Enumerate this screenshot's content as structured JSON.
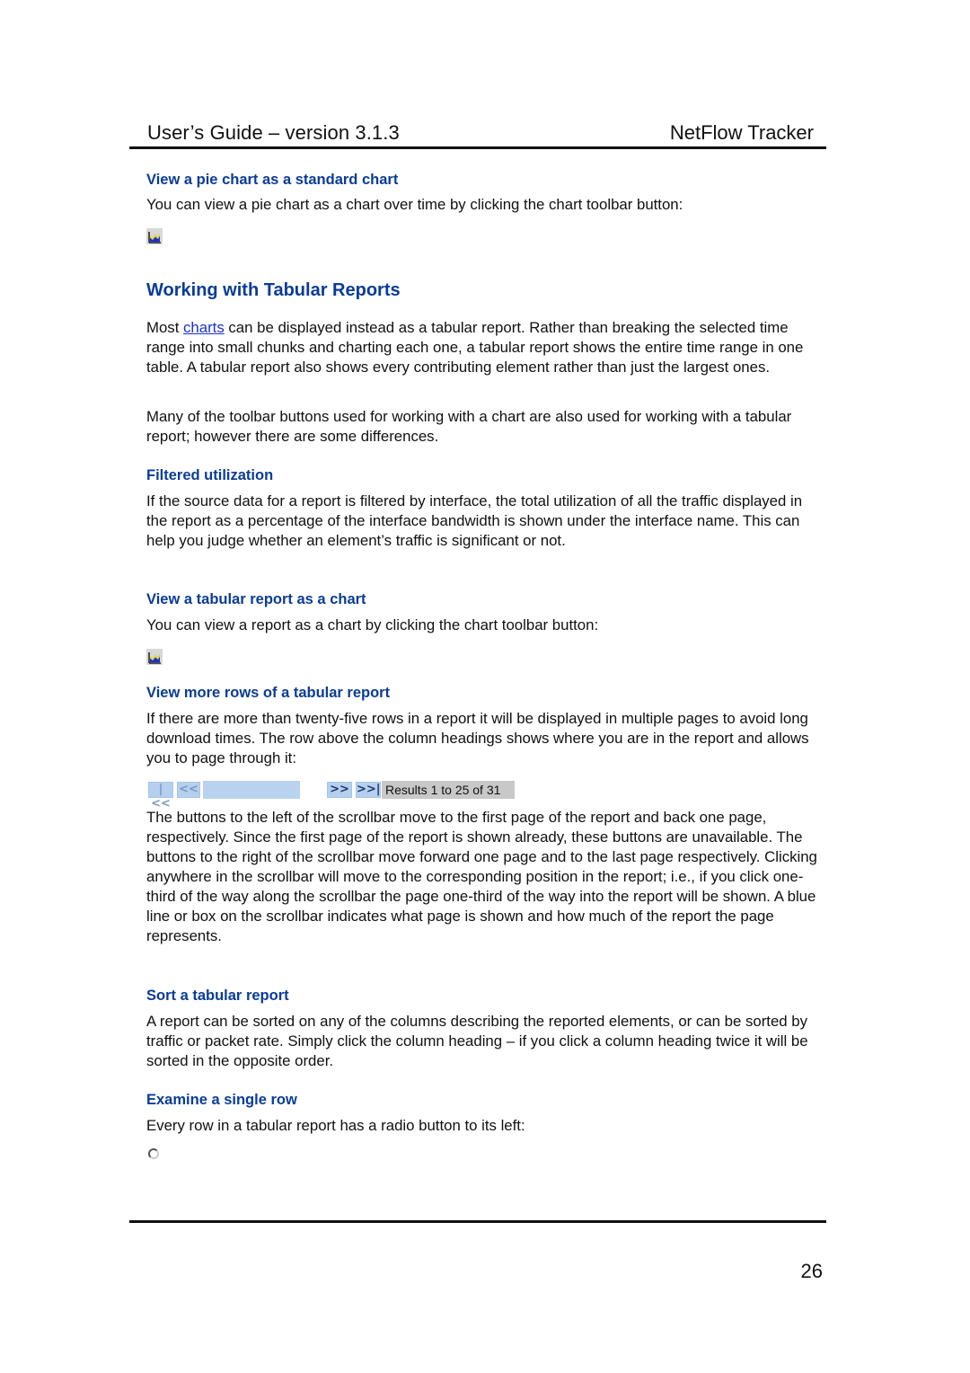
{
  "header": {
    "title": "User’s Guide – version 3.1.3",
    "product": "NetFlow Tracker"
  },
  "sections": {
    "pie_as_chart": {
      "heading": "View a pie chart as a standard chart",
      "text": "You can view a pie chart as a chart over time by clicking the chart toolbar button:",
      "icon": "chart-toolbar-icon"
    },
    "tabular": {
      "heading": "Working with Tabular Reports",
      "p1_before_link": "Most ",
      "p1_link": "charts",
      "p1_after_link": " can be displayed instead as a tabular report. Rather than breaking the selected time range into small chunks and charting each one, a tabular report shows the entire time range in one table. A tabular report also shows every contributing element rather than just the largest ones.",
      "p2": "Many of the toolbar buttons used for working with a chart are also used for working with a tabular report; however there are some differences."
    },
    "filtered": {
      "heading": "Filtered utilization",
      "text": "If the source data for a report is filtered by interface, the total utilization of all the traffic displayed in the report as a percentage of the interface bandwidth is shown under the interface name. This can help you judge whether an element’s traffic is significant or not."
    },
    "report_as_chart": {
      "heading": "View a tabular report as a chart",
      "text": "You can view a report as a chart by clicking the chart toolbar button:",
      "icon": "chart-toolbar-icon"
    },
    "more_rows": {
      "heading": "View more rows of a tabular report",
      "text": "If there are more than twenty-five rows in a report it will be displayed in multiple pages to avoid long download times. The row above the column headings shows where you are in the report and allows you to page through it:",
      "pager": {
        "first_label": "|<<",
        "prev_label": "<<",
        "next_label": ">>",
        "last_label": ">>|",
        "results_text": "Results 1 to 25 of 31"
      },
      "text2": "The buttons to the left of the scrollbar move to the first page of the report and back one page, respectively. Since the first page of the report is shown already, these buttons are unavailable. The buttons to the right of the scrollbar move forward one page and to the last page respectively. Clicking anywhere in the scrollbar will move to the corresponding position in the report; i.e., if you click one-third of the way along the scrollbar the page one-third of the way into the report will be shown. A blue line or box on the scrollbar indicates what page is shown and how much of the report the page represents."
    },
    "sort": {
      "heading": "Sort a tabular report",
      "text": "A report can be sorted on any of the columns describing the reported elements, or can be sorted by traffic or packet rate. Simply click the column heading – if you click a column heading twice it will be sorted in the opposite order."
    },
    "single_row": {
      "heading": "Examine a single row",
      "text": "Every row in a tabular report has a radio button to its left:"
    }
  },
  "footer": {
    "page_number": "26"
  },
  "colors": {
    "heading_blue": "#0a3c96",
    "link_blue": "#1a33cc",
    "scrollbar_blue": "#b8d2f0",
    "results_gray": "#c8c8c8"
  }
}
